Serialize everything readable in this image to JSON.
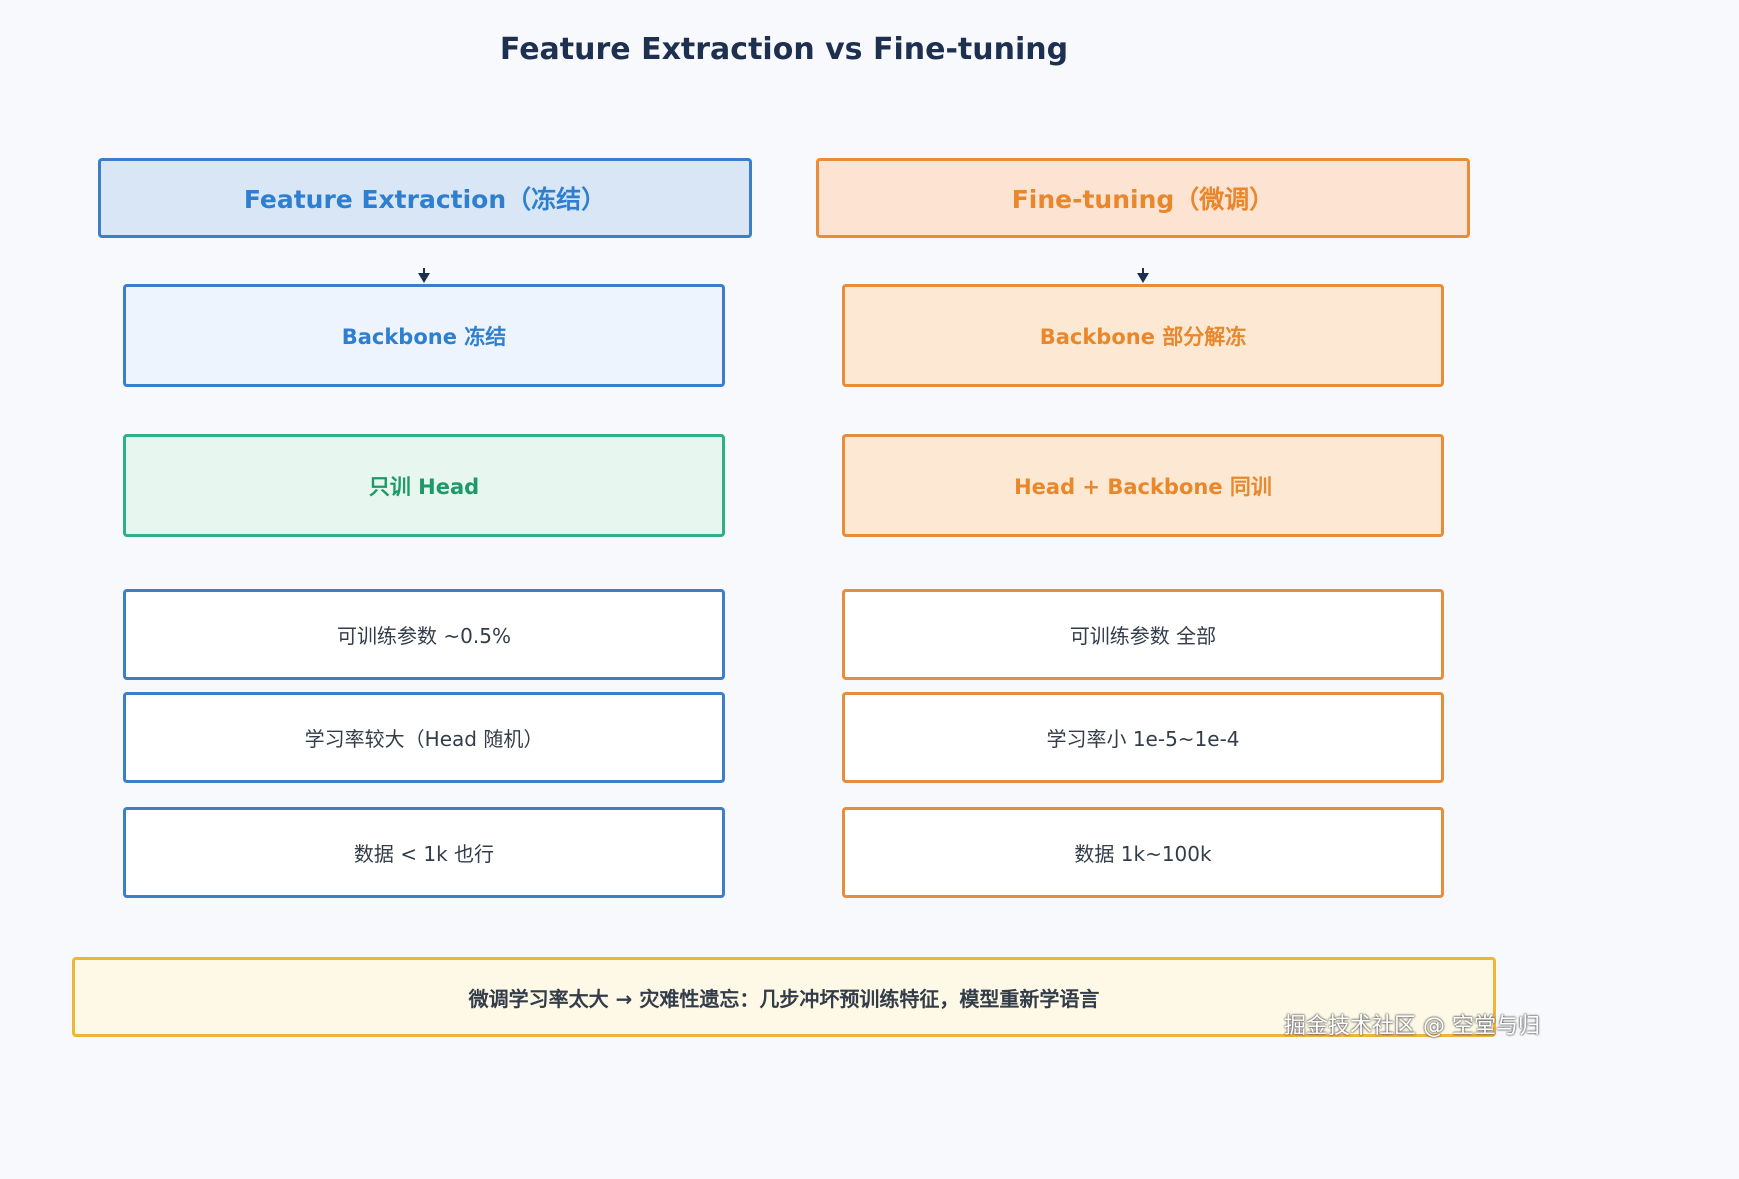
{
  "title": "Feature Extraction vs Fine-tuning",
  "left": {
    "header": "Feature Extraction（冻结）",
    "backbone": "Backbone 冻结",
    "train": "只训 Head",
    "stats": [
      "可训练参数 ~0.5%",
      "学习率较大（Head 随机）",
      "数据 < 1k 也行"
    ]
  },
  "right": {
    "header": "Fine-tuning（微调）",
    "backbone": "Backbone 部分解冻",
    "train": "Head + Backbone 同训",
    "stats": [
      "可训练参数 全部",
      "学习率小 1e-5~1e-4",
      "数据 1k~100k"
    ]
  },
  "note": "微调学习率太大 → 灾难性遗忘：几步冲坏预训练特征，模型重新学语言",
  "watermark": "掘金技术社区 @ 空堂与归",
  "colors": {
    "blue": "#3c7fc9",
    "green": "#2fb085",
    "orange": "#e88d3a",
    "yellow": "#f0b43a",
    "title": "#1e3050"
  }
}
